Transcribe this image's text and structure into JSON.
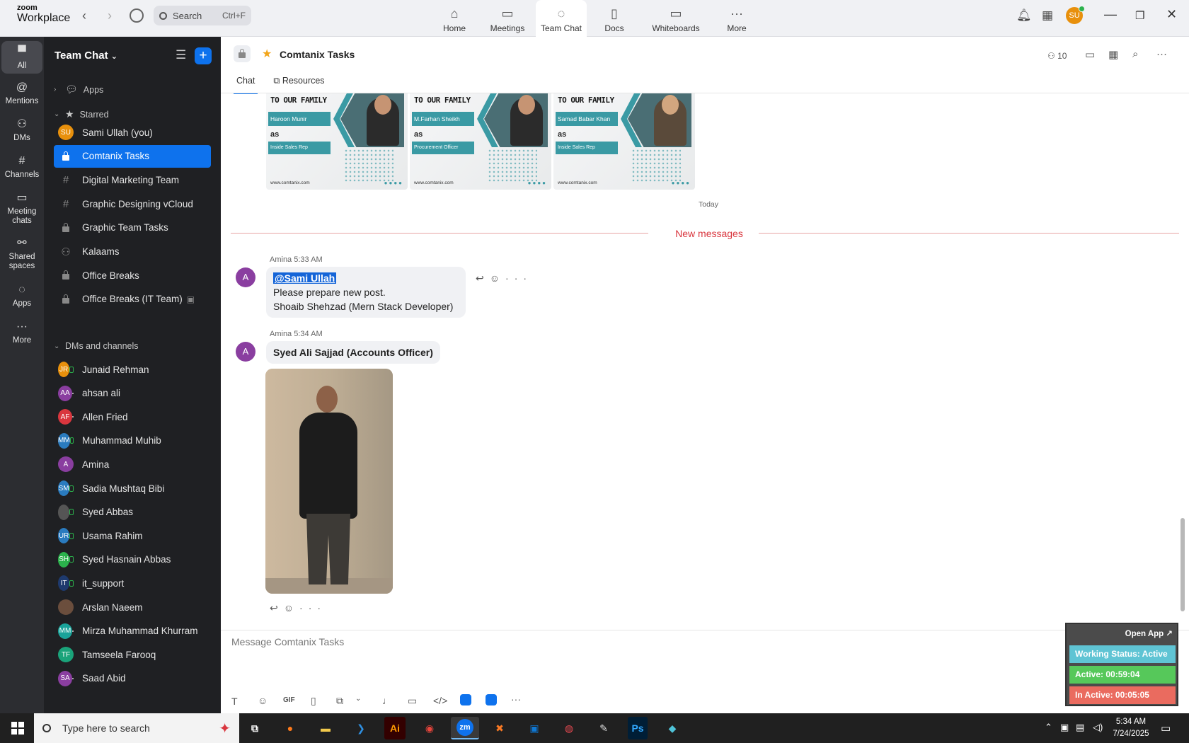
{
  "titlebar": {
    "logo_top": "zoom",
    "logo_bottom": "Workplace",
    "search_placeholder": "Search",
    "search_shortcut": "Ctrl+F",
    "nav": [
      {
        "label": "Home",
        "icon": "home-icon"
      },
      {
        "label": "Meetings",
        "icon": "video-icon"
      },
      {
        "label": "Team Chat",
        "icon": "chat-icon"
      },
      {
        "label": "Docs",
        "icon": "doc-icon"
      },
      {
        "label": "Whiteboards",
        "icon": "whiteboard-icon"
      },
      {
        "label": "More",
        "icon": "more-icon"
      }
    ],
    "avatar_initials": "SU"
  },
  "rail": [
    {
      "label": "All",
      "icon": "chat-bubble-icon"
    },
    {
      "label": "Mentions",
      "icon": "at-icon"
    },
    {
      "label": "DMs",
      "icon": "people-icon"
    },
    {
      "label": "Channels",
      "icon": "hash-icon"
    },
    {
      "label": "Meeting chats",
      "icon": "calendar-icon"
    },
    {
      "label": "Shared spaces",
      "icon": "share-icon"
    },
    {
      "label": "Apps",
      "icon": "apps-icon"
    },
    {
      "label": "More",
      "icon": "more-icon"
    }
  ],
  "sidebar": {
    "title": "Team Chat",
    "sections": {
      "apps": "Apps",
      "starred": "Starred",
      "dms": "DMs and channels"
    },
    "starred": [
      {
        "label": "Sami Ullah (you)",
        "type": "avatar",
        "initials": "SU",
        "color": "#e8900c",
        "status": "on"
      },
      {
        "label": "Comtanix Tasks",
        "type": "lock",
        "active": true
      },
      {
        "label": "Digital Marketing Team",
        "type": "hash"
      },
      {
        "label": "Graphic Designing vCloud",
        "type": "hash"
      },
      {
        "label": "Graphic Team Tasks",
        "type": "lock"
      },
      {
        "label": "Kalaams",
        "type": "group"
      },
      {
        "label": "Office Breaks",
        "type": "lock"
      },
      {
        "label": "Office Breaks (IT Team)",
        "type": "lock"
      }
    ],
    "dms": [
      {
        "label": "Junaid Rehman",
        "initials": "JR",
        "color": "#e8900c",
        "status": "mob"
      },
      {
        "label": "ahsan ali",
        "initials": "AA",
        "color": "#8a3ea0",
        "status": "off"
      },
      {
        "label": "Allen Fried",
        "initials": "AF",
        "color": "#d9363e",
        "status": "off"
      },
      {
        "label": "Muhammad Muhib",
        "initials": "MM",
        "color": "#2a7bbf",
        "status": "mob"
      },
      {
        "label": "Amina",
        "initials": "A",
        "color": "#8a3ea0",
        "status": "on"
      },
      {
        "label": "Sadia Mushtaq Bibi",
        "initials": "SM",
        "color": "#2a7bbf",
        "status": "mob"
      },
      {
        "label": "Syed Abbas",
        "initials": "",
        "color": "#555555",
        "status": "mob"
      },
      {
        "label": "Usama Rahim",
        "initials": "UR",
        "color": "#2a7bbf",
        "status": "mob"
      },
      {
        "label": "Syed Hasnain Abbas",
        "initials": "SH",
        "color": "#2bb24c",
        "status": "mob"
      },
      {
        "label": "it_support",
        "initials": "IT",
        "color": "#1e3a6e",
        "status": "mob"
      },
      {
        "label": "Arslan Naeem",
        "initials": "",
        "color": "#6b4e3d",
        "status": "on"
      },
      {
        "label": "Mirza Muhammad Khurram",
        "initials": "MM",
        "color": "#1aa39a",
        "status": "off"
      },
      {
        "label": "Tamseela Farooq",
        "initials": "TF",
        "color": "#1aa37a",
        "status": "on"
      },
      {
        "label": "Saad Abid",
        "initials": "SA",
        "color": "#8a3ea0",
        "status": "off"
      }
    ]
  },
  "header": {
    "title": "Comtanix Tasks",
    "member_count": "10",
    "tabs": [
      "Chat",
      "Resources"
    ]
  },
  "posters": [
    {
      "heading": "TO OUR FAMILY",
      "name": "Haroon Munir",
      "as": "as",
      "role": "Inside Sales Rep",
      "web": "www.comtanix.com"
    },
    {
      "heading": "TO OUR FAMILY",
      "name": "M.Farhan Sheikh",
      "as": "as",
      "role": "Procurement Officer",
      "web": "www.comtanix.com"
    },
    {
      "heading": "TO OUR FAMILY",
      "name": "Samad Babar Khan",
      "as": "as",
      "role": "Inside Sales Rep",
      "web": "www.comtanix.com"
    }
  ],
  "divider": {
    "today": "Today",
    "new_messages": "New messages"
  },
  "messages": [
    {
      "sender": "Amina",
      "time": "5:33 AM",
      "avatar": "A",
      "mention": "@Sami Ullah",
      "lines": [
        "Please prepare new post.",
        "Shoaib Shehzad (Mern Stack Developer)"
      ]
    },
    {
      "sender": "Amina",
      "time": "5:34 AM",
      "avatar": "A",
      "text": "Syed Ali Sajjad (Accounts Officer)"
    }
  ],
  "composer": {
    "placeholder": "Message Comtanix Tasks",
    "gif_label": "GIF"
  },
  "tracker": {
    "open_app": "Open App ↗",
    "working_status": "Working Status: Active",
    "active": "Active: 00:59:04",
    "inactive": "In Active: 00:05:05",
    "colors": {
      "status": "#5fc4d4",
      "active": "#56c85a",
      "inactive": "#ea6b5f"
    }
  },
  "taskbar": {
    "search_placeholder": "Type here to search",
    "time": "5:34 AM",
    "date": "7/24/2025",
    "apps": [
      "task-view",
      "firefox",
      "file-explorer",
      "vscode",
      "Ai",
      "chrome",
      "zm",
      "xampp",
      "outlook",
      "creative-cloud",
      "pen-tool",
      "Ps",
      "app"
    ]
  }
}
